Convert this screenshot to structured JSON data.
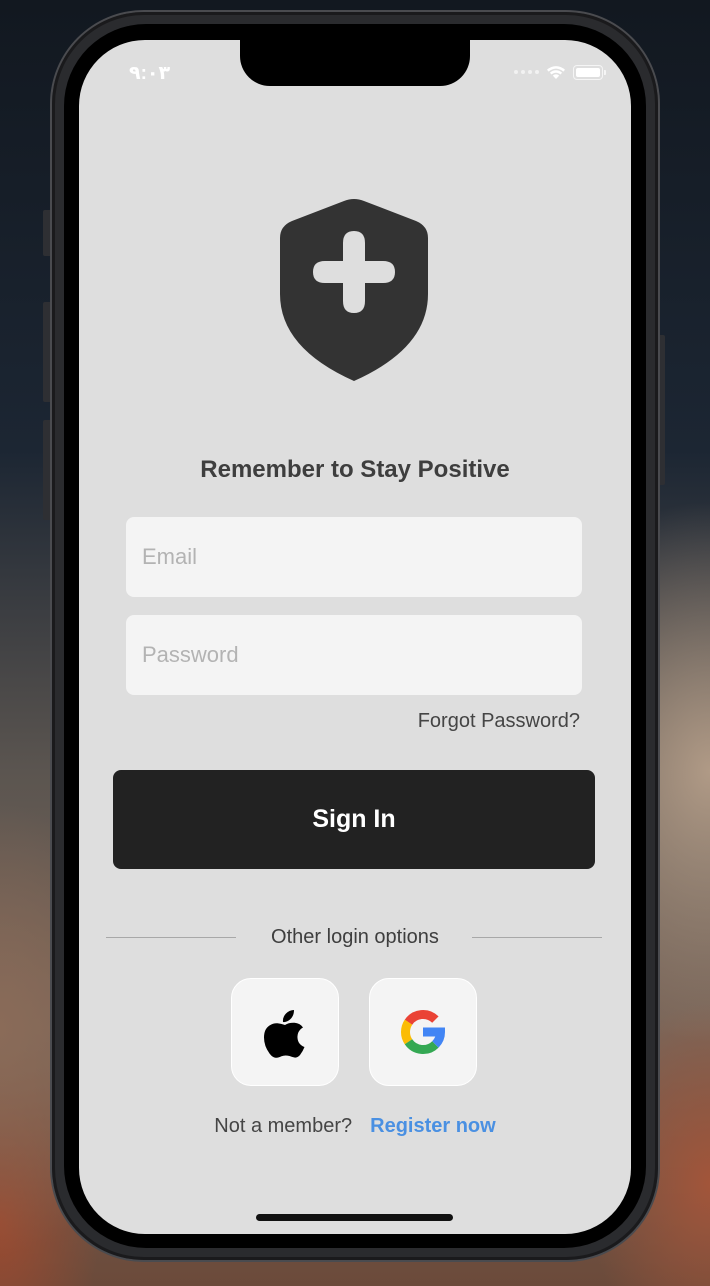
{
  "status_bar": {
    "time": "٩:٠٣"
  },
  "headline": "Remember to Stay Positive",
  "form": {
    "email_placeholder": "Email",
    "password_placeholder": "Password",
    "forgot_label": "Forgot Password?",
    "signin_label": "Sign In"
  },
  "other_options_label": "Other login options",
  "social_buttons": [
    {
      "icon": "apple-icon"
    },
    {
      "icon": "google-icon"
    }
  ],
  "footer": {
    "prompt": "Not a member?",
    "register_label": "Register now"
  },
  "colors": {
    "screen_bg": "#dedede",
    "button_bg": "#222222",
    "link": "#4a90e2",
    "logo": "#333333"
  }
}
